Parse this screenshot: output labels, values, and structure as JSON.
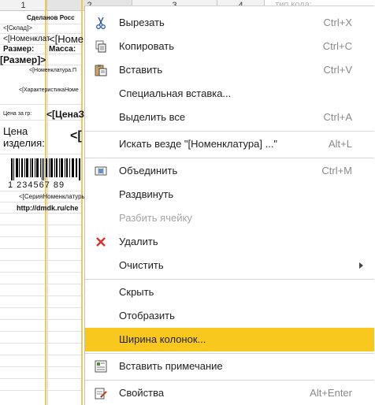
{
  "sheet": {
    "columns": [
      "1",
      "2",
      "3",
      "4"
    ],
    "right_hint": "...тип кода:",
    "cells": {
      "made_in": "Сделанов Росс",
      "warehouse": "<[Склад]>",
      "nomenclature_a": "<[Номенклат",
      "nomenclature_b": "<[Номе",
      "size_label": "Размер:",
      "mass_label": "Масса:",
      "size_param": "[Размер]>",
      "nomenclature_small": "<[Номенклатура.П",
      "characteristic": "<[ХарактеристикаНоме",
      "price_per_g": "Цена за гр:",
      "price_param": "<[ЦенаЗ",
      "price_label_1": "Цена",
      "price_label_2": "изделия:",
      "price_big": "<[",
      "barcode_digits": "1 234567 89",
      "series": "<[СерияНоменклатуры",
      "url": "http://dmdk.ru/che"
    }
  },
  "menu": {
    "items": [
      {
        "label": "Вырезать",
        "shortcut": "Ctrl+X",
        "icon": "scissors-icon"
      },
      {
        "label": "Копировать",
        "shortcut": "Ctrl+C",
        "icon": "copy-icon"
      },
      {
        "label": "Вставить",
        "shortcut": "Ctrl+V",
        "icon": "paste-icon"
      },
      {
        "label": "Специальная вставка...",
        "shortcut": ""
      },
      {
        "label": "Выделить все",
        "shortcut": "Ctrl+A"
      },
      {
        "label": "Искать везде \"[Номенклатура] ...\"",
        "shortcut": "Alt+L"
      },
      {
        "label": "Объединить",
        "shortcut": "Ctrl+M",
        "icon": "merge-cells-icon"
      },
      {
        "label": "Раздвинуть",
        "shortcut": ""
      },
      {
        "label": "Разбить ячейку",
        "shortcut": "",
        "disabled": true
      },
      {
        "label": "Удалить",
        "shortcut": "",
        "icon": "delete-x-icon"
      },
      {
        "label": "Очистить",
        "shortcut": "",
        "submenu": true
      },
      {
        "label": "Скрыть",
        "shortcut": ""
      },
      {
        "label": "Отобразить",
        "shortcut": ""
      },
      {
        "label": "Ширина колонок...",
        "shortcut": "",
        "highlighted": true
      },
      {
        "label": "Вставить примечание",
        "shortcut": "",
        "icon": "note-icon"
      },
      {
        "label": "Свойства",
        "shortcut": "Alt+Enter",
        "icon": "properties-icon"
      }
    ]
  },
  "colors": {
    "highlight": "#f8c81e",
    "delete_red": "#d9342b",
    "column_marker": "#f2c94c"
  }
}
